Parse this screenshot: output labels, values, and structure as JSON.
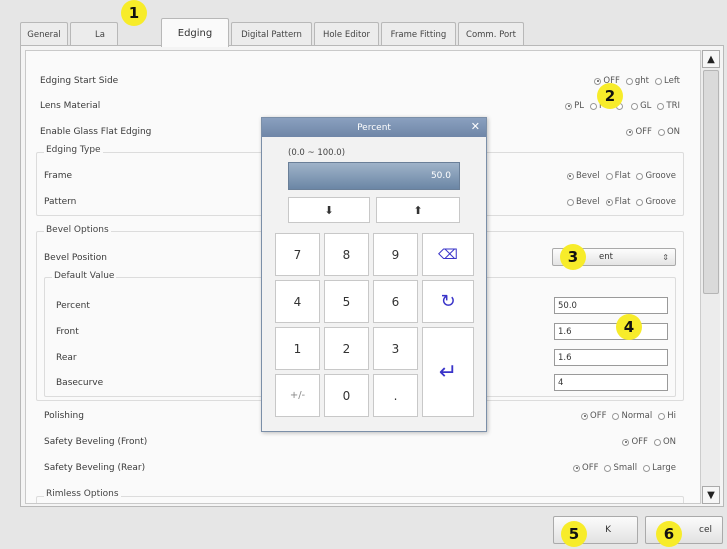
{
  "tabs": [
    {
      "label": "General"
    },
    {
      "label": "La"
    },
    {
      "label": "Edging",
      "active": true
    },
    {
      "label": "Digital Pattern"
    },
    {
      "label": "Hole Editor"
    },
    {
      "label": "Frame Fitting"
    },
    {
      "label": "Comm. Port"
    }
  ],
  "form": {
    "edging_start_side": {
      "label": "Edging Start Side",
      "options": [
        "OFF",
        "ght",
        "Left"
      ],
      "selected": "OFF"
    },
    "lens_material": {
      "label": "Lens Material",
      "options": [
        "PL",
        "PC",
        "",
        "GL",
        "TRI"
      ],
      "selected": "PL"
    },
    "glass_flat": {
      "label": "Enable Glass Flat Edging",
      "options": [
        "OFF",
        "ON"
      ],
      "selected": "OFF"
    },
    "edging_type_title": "Edging Type",
    "frame": {
      "label": "Frame",
      "options": [
        "Bevel",
        "Flat",
        "Groove"
      ],
      "selected": "Bevel"
    },
    "pattern": {
      "label": "Pattern",
      "options": [
        "Bevel",
        "Flat",
        "Groove"
      ],
      "selected": "Flat"
    },
    "bevel_options_title": "Bevel Options",
    "bevel_position": {
      "label": "Bevel Position",
      "value": "ent"
    },
    "default_value_title": "Default Value",
    "percent": {
      "label": "Percent",
      "value": "50.0"
    },
    "front": {
      "label": "Front",
      "value": "1.6"
    },
    "rear": {
      "label": "Rear",
      "value": "1.6"
    },
    "basecurve": {
      "label": "Basecurve",
      "value": "4"
    },
    "polishing": {
      "label": "Polishing",
      "options": [
        "OFF",
        "Normal",
        "Hi"
      ],
      "selected": "OFF"
    },
    "safety_front": {
      "label": "Safety Beveling (Front)",
      "options": [
        "OFF",
        "ON"
      ],
      "selected": "OFF"
    },
    "safety_rear": {
      "label": "Safety Beveling (Rear)",
      "options": [
        "OFF",
        "Small",
        "Large"
      ],
      "selected": "OFF"
    },
    "rimless_title": "Rimless Options"
  },
  "scrollbar": {
    "up": "▲",
    "down": "▼"
  },
  "dialog": {
    "title": "Percent",
    "close": "✕",
    "range": "(0.0 ~ 100.0)",
    "display_value": "50.0",
    "keys": [
      "7",
      "8",
      "9",
      "4",
      "5",
      "6",
      "1",
      "2",
      "3",
      "+/-",
      "0",
      "."
    ],
    "backspace": "⌫",
    "reset": "↻",
    "enter": "↵",
    "decrease": "⬇",
    "increase": "⬆"
  },
  "buttons": {
    "ok": "K",
    "cancel": "cel"
  },
  "markers": [
    "1",
    "2",
    "3",
    "4",
    "5",
    "6"
  ]
}
